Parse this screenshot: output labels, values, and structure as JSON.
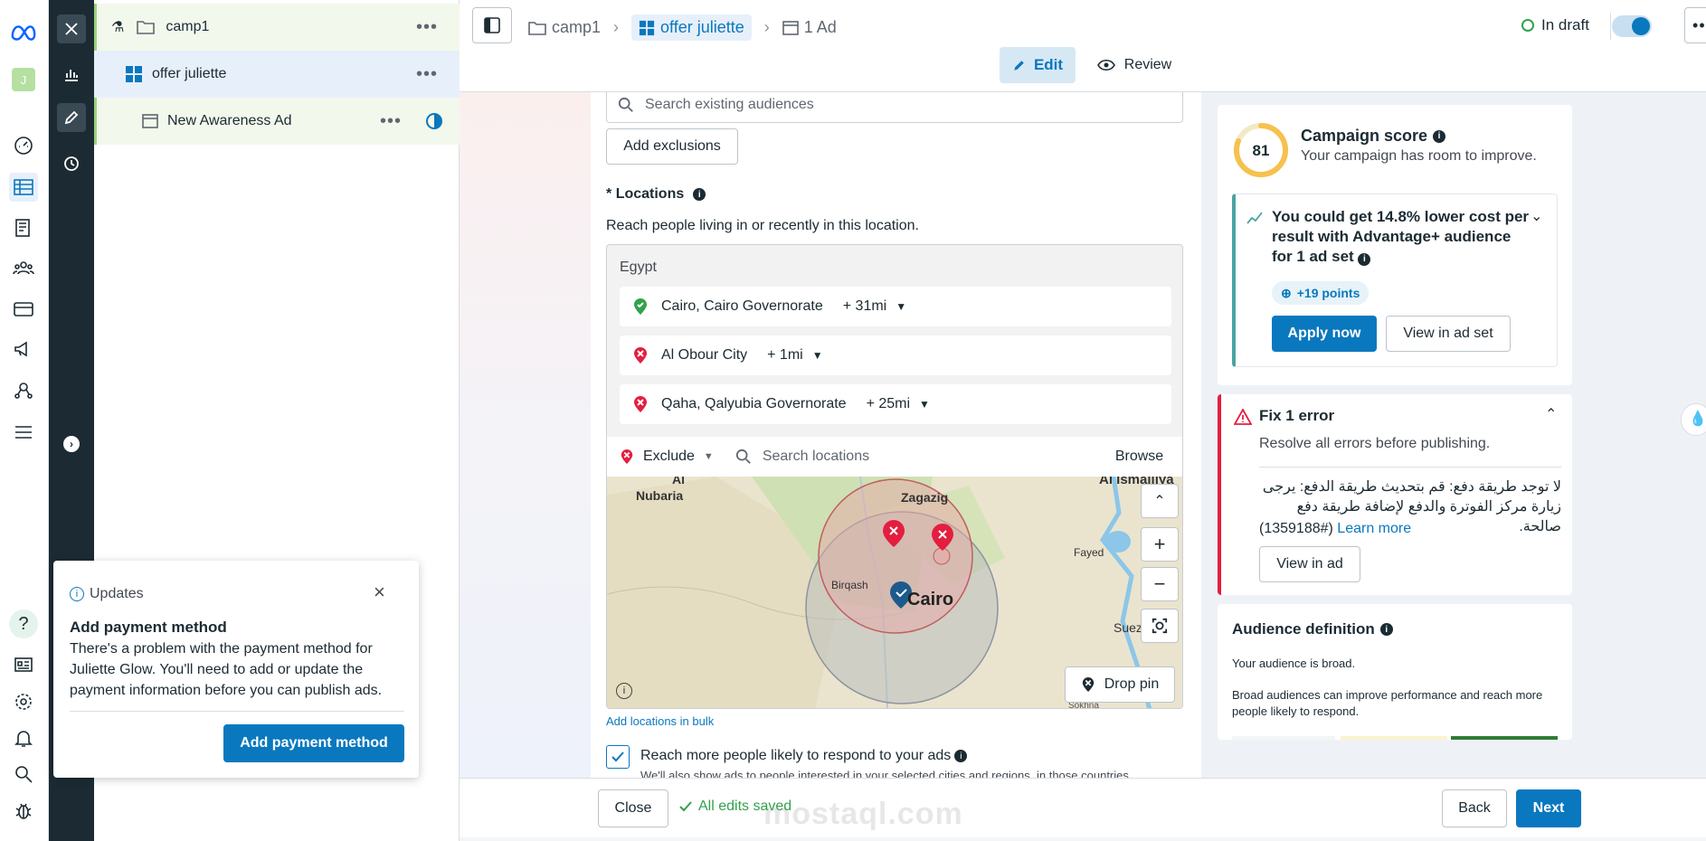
{
  "breadcrumb": {
    "campaign": "camp1",
    "adset": "offer juliette",
    "ad": "1 Ad"
  },
  "status": {
    "label": "In draft"
  },
  "modes": {
    "edit": "Edit",
    "review": "Review"
  },
  "tree": {
    "campaign": "camp1",
    "adset": "offer juliette",
    "ad": "New Awareness Ad"
  },
  "avatar": {
    "initial": "J"
  },
  "audience": {
    "search_placeholder": "Search existing audiences",
    "add_exclusions": "Add exclusions"
  },
  "locations": {
    "title": "Locations",
    "required_mark": "*",
    "subtitle": "Reach people living in or recently in this location.",
    "country": "Egypt",
    "items": [
      {
        "name": "Cairo, Cairo Governorate",
        "radius": "+ 31mi",
        "type": "include"
      },
      {
        "name": "Al Obour City",
        "radius": "+ 1mi",
        "type": "exclude"
      },
      {
        "name": "Qaha, Qalyubia Governorate",
        "radius": "+ 25mi",
        "type": "exclude"
      }
    ],
    "mode": "Exclude",
    "search_placeholder": "Search locations",
    "browse": "Browse",
    "bulk_link": "Add locations in bulk",
    "drop_pin": "Drop pin",
    "map_labels": {
      "a": "Al",
      "b": "Nubaria",
      "c": "Zagazig",
      "d": "Al Ismailiya",
      "e": "Fayed",
      "f": "Birqash",
      "g": "Cairo",
      "h": "Suez",
      "i": "Sokhna"
    }
  },
  "reach": {
    "label": "Reach more people likely to respond to your ads",
    "desc": "We'll also show ads to people interested in your selected cities and regions, in those countries."
  },
  "score": {
    "value": "81",
    "fraction": 0.81,
    "title": "Campaign score",
    "subtitle": "Your campaign has room to improve."
  },
  "recommendation": {
    "text": "You could get 14.8% lower cost per result with Advantage+ audience for 1 ad set",
    "points": "+19 points",
    "apply": "Apply now",
    "view": "View in ad set"
  },
  "error": {
    "title": "Fix 1 error",
    "subtitle": "Resolve all errors before publishing.",
    "message": "لا توجد طريقة دفع: قم بتحديث طريقة الدفع: يرجى زيارة مركز الفوترة والدفع لإضافة طريقة دفع صالحة.",
    "code": "(1359188#)",
    "learn": "Learn more",
    "view": "View in ad"
  },
  "audience_def": {
    "title": "Audience definition",
    "line1": "Your audience is broad.",
    "line2": "Broad audiences can improve performance and reach more people likely to respond."
  },
  "footer": {
    "close": "Close",
    "saved": "All edits saved",
    "back": "Back",
    "next": "Next"
  },
  "updates": {
    "header": "Updates",
    "title": "Add payment method",
    "body": "There's a problem with the payment method for Juliette Glow. You'll need to add or update the payment information before you can publish ads.",
    "button": "Add payment method"
  },
  "watermark": "mostaql.com",
  "colors": {
    "accent": "#0a78be",
    "error": "#e41e3f",
    "success": "#31a24c",
    "score": "#f7c14e"
  }
}
